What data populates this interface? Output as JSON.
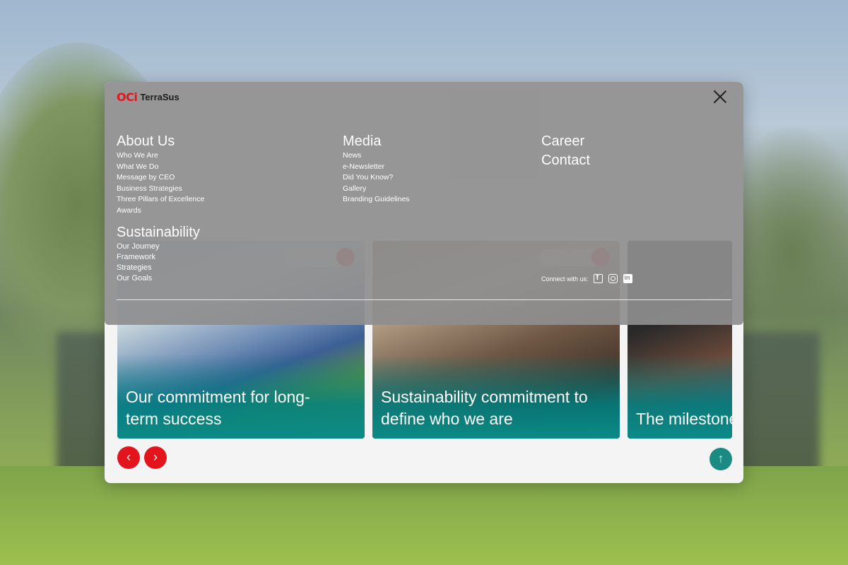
{
  "brand": {
    "mark": "OCi",
    "name": "TerraSus"
  },
  "menu": {
    "about": {
      "title": "About Us",
      "items": [
        "Who We Are",
        "What We Do",
        "Message by CEO",
        "Business Strategies",
        "Three Pillars of Excellence",
        "Awards"
      ]
    },
    "media": {
      "title": "Media",
      "items": [
        "News",
        "e-Newsletter",
        "Did You Know?",
        "Gallery",
        "Branding Guidelines"
      ]
    },
    "sustainability": {
      "title": "Sustainability",
      "items": [
        "Our Journey",
        "Framework",
        "Strategies",
        "Our Goals"
      ]
    },
    "career": {
      "title": "Career"
    },
    "contact": {
      "title": "Contact"
    },
    "connect_label": "Connect with us:",
    "social_icons": [
      "facebook-icon",
      "instagram-icon",
      "linkedin-icon"
    ]
  },
  "page": {
    "cards": [
      {
        "caption": "Our commitment for long-term success"
      },
      {
        "caption": "Sustainability commitment to define who we are"
      },
      {
        "caption": "The milestone journey forwa"
      }
    ],
    "prev_icon": "chevron-left-icon",
    "next_icon": "chevron-right-icon",
    "scroll_top_icon": "arrow-up-icon"
  },
  "colors": {
    "accent": "#e4141d",
    "teal": "#1a8a83",
    "menu_bg": "#8e8e8e"
  }
}
